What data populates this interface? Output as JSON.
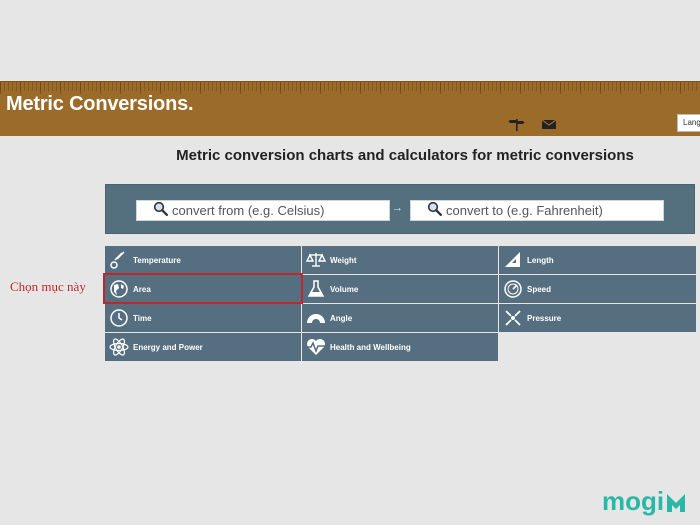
{
  "header": {
    "logo": "Metric Conversions.",
    "language_button": "Lang",
    "icons": [
      "signpost-icon",
      "mail-icon"
    ]
  },
  "headline": "Metric conversion charts and calculators for metric conversions",
  "search": {
    "from_placeholder": "convert from (e.g. Celsius)",
    "to_placeholder": "convert to (e.g. Fahrenheit)",
    "arrow": "→"
  },
  "categories": [
    {
      "label": "Temperature",
      "icon": "thermometer-icon"
    },
    {
      "label": "Weight",
      "icon": "scale-icon"
    },
    {
      "label": "Length",
      "icon": "ruler-icon"
    },
    {
      "label": "Area",
      "icon": "globe-icon"
    },
    {
      "label": "Volume",
      "icon": "flask-icon"
    },
    {
      "label": "Speed",
      "icon": "speedometer-icon"
    },
    {
      "label": "Time",
      "icon": "clock-icon"
    },
    {
      "label": "Angle",
      "icon": "protractor-icon"
    },
    {
      "label": "Pressure",
      "icon": "pressure-icon"
    },
    {
      "label": "Energy and Power",
      "icon": "atom-icon"
    },
    {
      "label": "Health and Wellbeing",
      "icon": "heartbeat-icon"
    }
  ],
  "annotation": {
    "text": "Chọn mục này",
    "color": "#c0272d"
  },
  "watermark": "mogi",
  "colors": {
    "header": "#9b6b2a",
    "tile": "#566f80",
    "watermark": "#29b7a7"
  }
}
